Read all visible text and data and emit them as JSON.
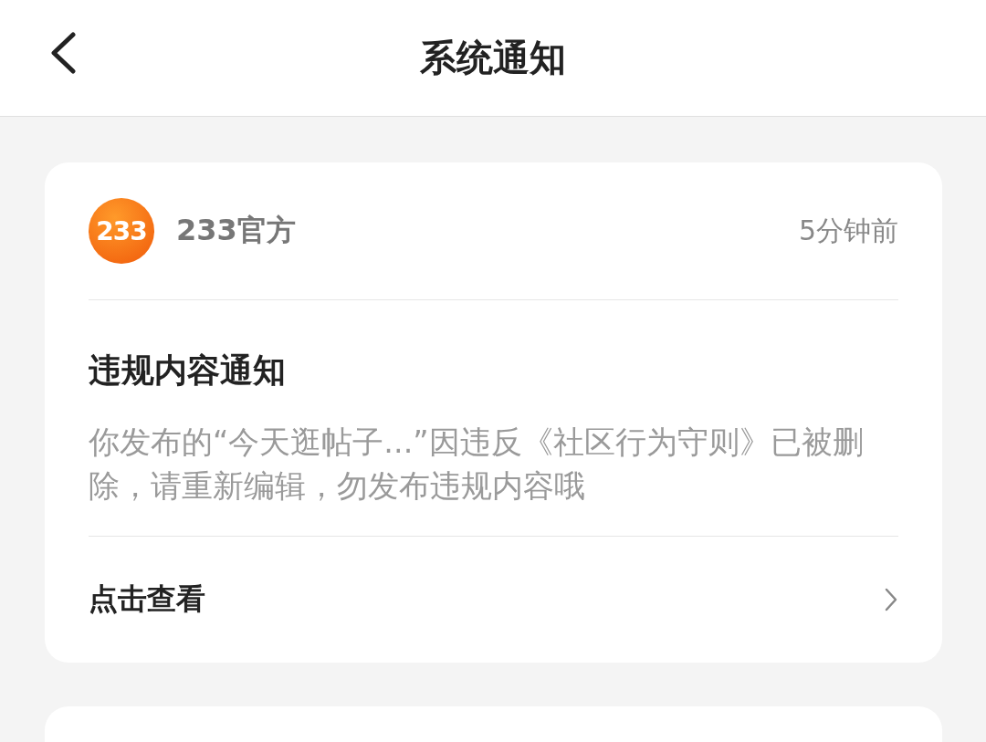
{
  "header": {
    "title": "系统通知"
  },
  "notifications": [
    {
      "logo_text": "233",
      "sender": "233官方",
      "time": "5分钟前",
      "title": "违规内容通知",
      "body": "你发布的“今天逛帖子...”因违反《社区行为守则》已被删除，请重新编辑，勿发布违规内容哦",
      "action": "点击查看"
    }
  ]
}
